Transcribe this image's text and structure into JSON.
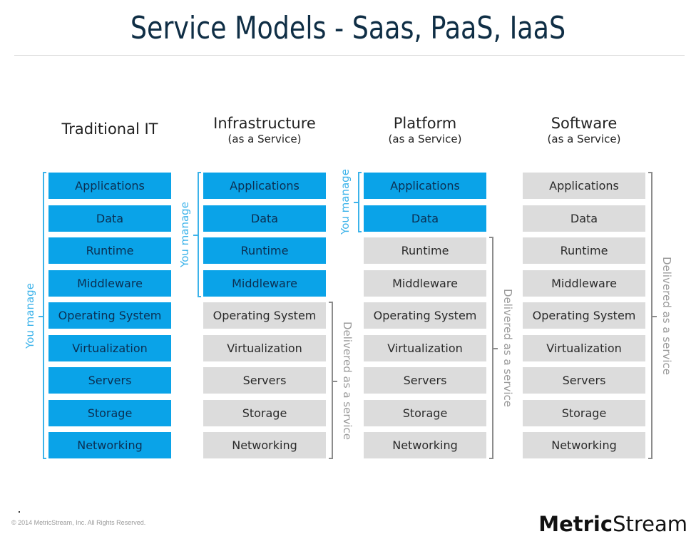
{
  "header": {
    "title": "Service Models - Saas, PaaS, IaaS"
  },
  "layers": [
    "Applications",
    "Data",
    "Runtime",
    "Middleware",
    "Operating System",
    "Virtualization",
    "Servers",
    "Storage",
    "Networking"
  ],
  "columns": [
    {
      "title": "Traditional IT",
      "subtitle": "",
      "managed_count": 9,
      "managed_label": "You manage",
      "delivered_label": ""
    },
    {
      "title": "Infrastructure",
      "subtitle": "(as a Service)",
      "managed_count": 4,
      "managed_label": "You manage",
      "delivered_label": "Delivered as a service"
    },
    {
      "title": "Platform",
      "subtitle": "(as a Service)",
      "managed_count": 2,
      "managed_label": "You manage",
      "delivered_label": "Delivered as a service"
    },
    {
      "title": "Software",
      "subtitle": "(as a Service)",
      "managed_count": 0,
      "managed_label": "",
      "delivered_label": "Delivered as a service"
    }
  ],
  "colors": {
    "managed": "#0aa3e8",
    "delivered": "#dcdcdc",
    "managed_label": "#3cb3ea",
    "delivered_label": "#9a9a9a",
    "title": "#0f2e45"
  },
  "footer": {
    "copyright": "© 2014 MetricStream, Inc. All Rights Reserved.",
    "logo_bold": "Metric",
    "logo_regular": "Stream"
  }
}
